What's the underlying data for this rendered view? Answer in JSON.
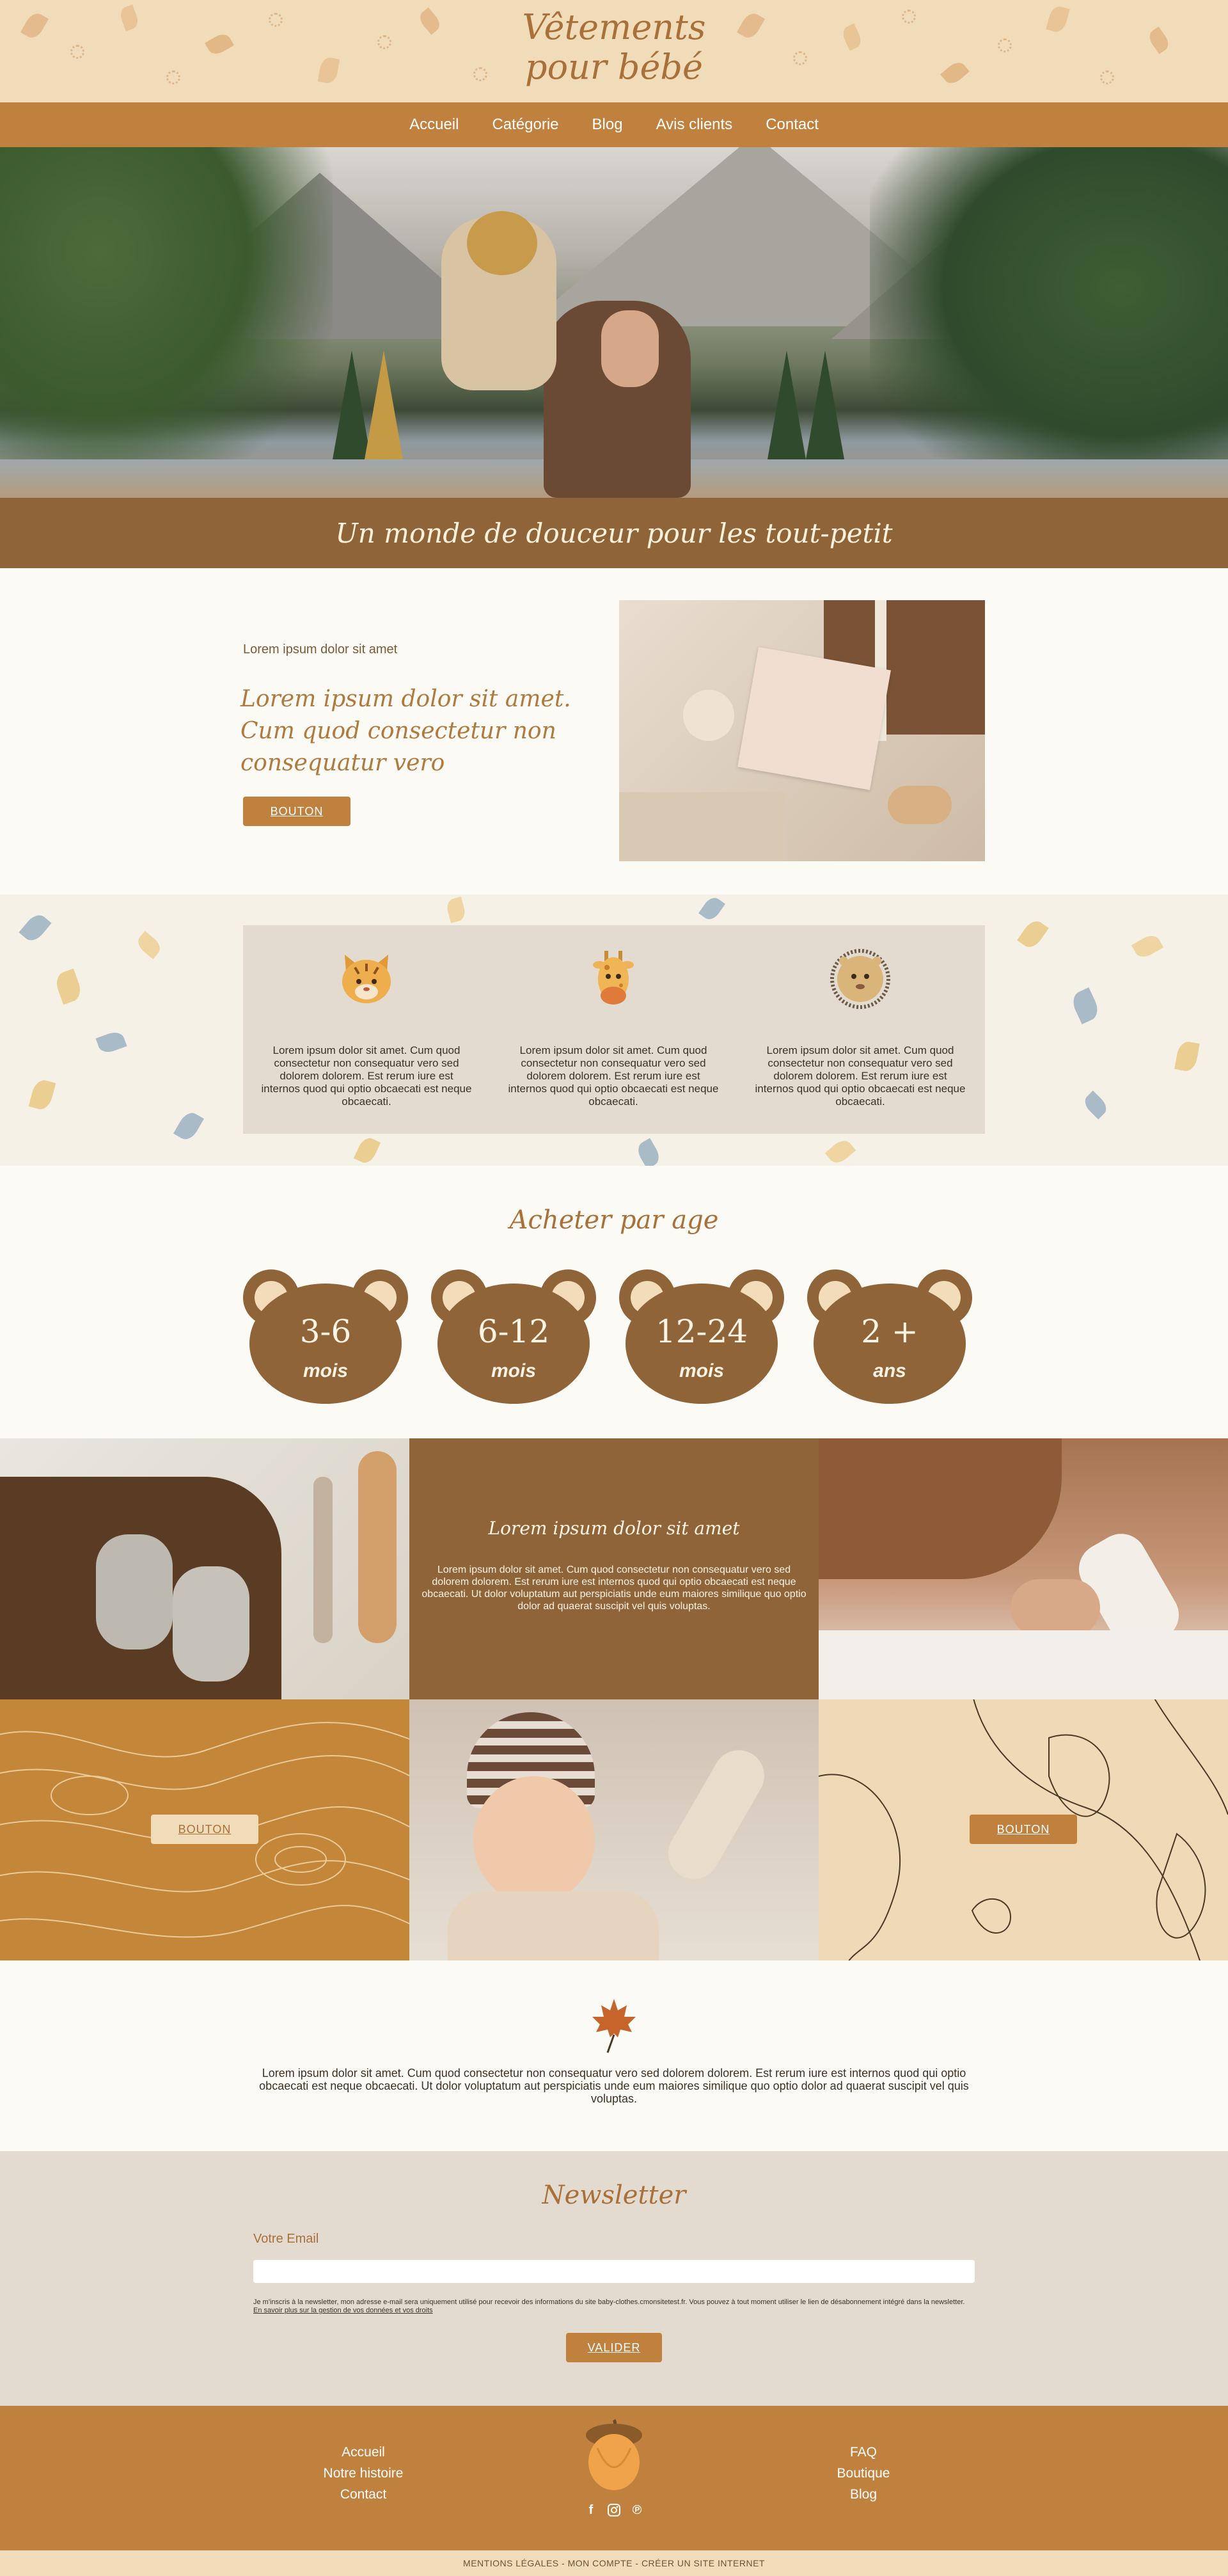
{
  "header": {
    "title_line1": "Vêtements",
    "title_line2": "pour bébé"
  },
  "nav": {
    "items": [
      "Accueil",
      "Catégorie",
      "Blog",
      "Avis clients",
      "Contact"
    ]
  },
  "tagline": "Un monde de douceur pour les tout-petit",
  "intro": {
    "kicker": "Lorem ipsum dolor sit amet",
    "heading": "Lorem ipsum dolor sit amet. Cum quod consectetur non consequatur vero",
    "button": "BOUTON"
  },
  "animals": [
    {
      "icon": "tiger-icon",
      "text": "Lorem ipsum dolor sit amet. Cum quod consectetur non consequatur vero sed dolorem dolorem. Est rerum iure est internos quod qui optio obcaecati est neque obcaecati."
    },
    {
      "icon": "giraffe-icon",
      "text": "Lorem ipsum dolor sit amet. Cum quod consectetur non consequatur vero sed dolorem dolorem. Est rerum iure est internos quod qui optio obcaecati est neque obcaecati."
    },
    {
      "icon": "lion-icon",
      "text": "Lorem ipsum dolor sit amet. Cum quod consectetur non consequatur vero sed dolorem dolorem. Est rerum iure est internos quod qui optio obcaecati est neque obcaecati."
    }
  ],
  "ages": {
    "title": "Acheter par age",
    "items": [
      {
        "num": "3-6",
        "unit": "mois"
      },
      {
        "num": "6-12",
        "unit": "mois"
      },
      {
        "num": "12-24",
        "unit": "mois"
      },
      {
        "num": "2 +",
        "unit": "ans"
      }
    ]
  },
  "grid": {
    "heading": "Lorem ipsum dolor sit amet",
    "body": "Lorem ipsum dolor sit amet. Cum quod consectetur non consequatur vero sed dolorem dolorem. Est rerum iure est internos quod qui optio obcaecati est neque obcaecati. Ut dolor voluptatum aut perspiciatis unde eum maiores similique quo optio dolor ad quaerat suscipit vel quis voluptas.",
    "button_left": "BOUTON",
    "button_right": "BOUTON"
  },
  "quote": "Lorem ipsum dolor sit amet. Cum quod consectetur non consequatur vero sed dolorem dolorem. Est rerum iure est internos quod qui optio obcaecati est neque obcaecati. Ut dolor voluptatum aut perspiciatis unde eum maiores similique quo optio dolor ad quaerat suscipit vel quis voluptas.",
  "newsletter": {
    "title": "Newsletter",
    "label": "Votre Email",
    "placeholder": "",
    "consent": "Je m'inscris à la newsletter, mon adresse e-mail sera uniquement utilisé pour recevoir des informations du site baby-clothes.cmonsitetest.fr. Vous pouvez à tout moment utiliser le lien de désabonnement intégré dans la newsletter.",
    "consent_link": "En savoir plus sur la gestion de vos données et vos droits",
    "button": "VALIDER"
  },
  "footer": {
    "left": [
      "Accueil",
      "Notre histoire",
      "Contact"
    ],
    "right": [
      "FAQ",
      "Boutique",
      "Blog"
    ],
    "socials": [
      "facebook-icon",
      "instagram-icon",
      "pinterest-icon"
    ]
  },
  "bottom_bar": "MENTIONS LÉGALES - MON COMPTE - CRÉER UN SITE INTERNET",
  "colors": {
    "accent": "#c0813f",
    "brown": "#8f6438",
    "cream": "#f1dcb9",
    "beige": "#e4dbd0",
    "title": "#a9703a"
  }
}
